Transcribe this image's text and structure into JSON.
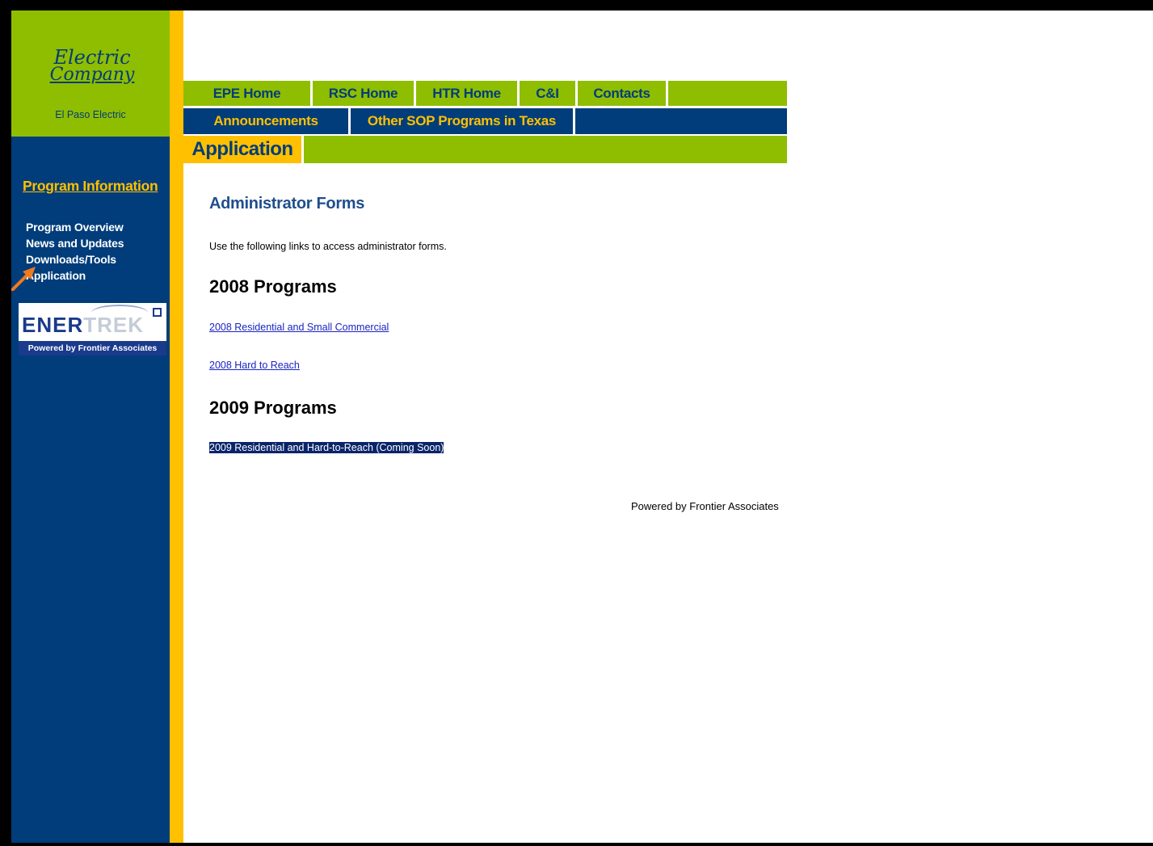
{
  "logo": {
    "script_line1": "Electric",
    "script_line2": "Company",
    "subtitle": "El Paso Electric"
  },
  "sidebar": {
    "heading": "Program Information",
    "items": [
      {
        "label": "Program Overview"
      },
      {
        "label": "News and Updates"
      },
      {
        "label": "Downloads/Tools"
      },
      {
        "label": "Application"
      }
    ],
    "badge": {
      "word_left": "ENER",
      "word_right": "TREK",
      "powered": "Powered by Frontier Associates"
    }
  },
  "nav": {
    "row1": [
      {
        "label": "EPE Home"
      },
      {
        "label": "RSC Home"
      },
      {
        "label": "HTR Home"
      },
      {
        "label": "C&I"
      },
      {
        "label": "Contacts"
      }
    ],
    "row2": [
      {
        "label": "Announcements"
      },
      {
        "label": "Other SOP Programs in Texas"
      }
    ],
    "row3_active": "Application"
  },
  "main": {
    "title": "Administrator Forms",
    "intro": "Use the following links to access administrator forms.",
    "sections": [
      {
        "heading": "2008 Programs",
        "links": [
          "2008 Residential and Small Commercial",
          "2008 Hard to Reach"
        ]
      },
      {
        "heading": "2009 Programs",
        "links": [
          "2009 Residential and Hard-to-Reach (Coming Soon)"
        ]
      }
    ]
  },
  "footer": "Powered by Frontier Associates",
  "colors": {
    "green": "#8fbd00",
    "navy": "#003d7a",
    "gold": "#ffc000",
    "link": "#1a24c0",
    "selection": "#0a246a"
  }
}
